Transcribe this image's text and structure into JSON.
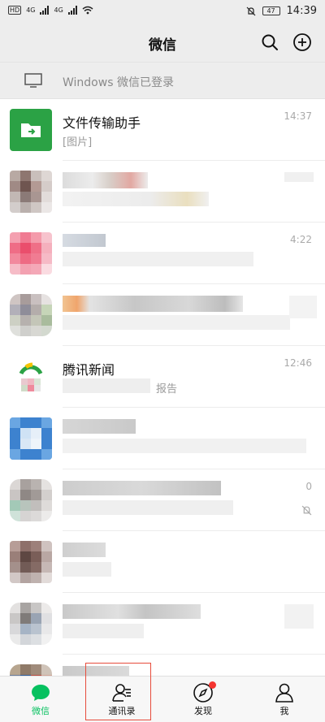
{
  "status_bar": {
    "time": "14:39",
    "battery": "47",
    "network_left": "4G",
    "network_right": "4G",
    "hd_badge": "HD"
  },
  "header": {
    "title": "微信",
    "search_icon": "search-icon",
    "add_icon": "plus-circle-icon"
  },
  "windows_bar": {
    "text": "Windows 微信已登录",
    "icon": "monitor-icon"
  },
  "chats": [
    {
      "name": "文件传输助手",
      "preview": "[图片]",
      "time": "14:37"
    },
    {
      "name": "",
      "preview": "",
      "time": ""
    },
    {
      "name": "",
      "preview": "",
      "time": "4:22"
    },
    {
      "name": "",
      "preview": "",
      "time": ""
    },
    {
      "name": "腾讯新闻",
      "preview": "报告",
      "time": "12:46"
    },
    {
      "name": "",
      "preview": "",
      "time": ""
    },
    {
      "name": "",
      "preview": "",
      "time": "0"
    },
    {
      "name": "",
      "preview": "",
      "time": ""
    },
    {
      "name": "",
      "preview": "",
      "time": ""
    },
    {
      "name": "",
      "preview": "",
      "time": ""
    }
  ],
  "tabs": [
    {
      "label": "微信",
      "icon": "chat-bubble-icon",
      "active": true
    },
    {
      "label": "通讯录",
      "icon": "contacts-icon",
      "active": false
    },
    {
      "label": "发现",
      "icon": "compass-icon",
      "active": false,
      "badge_dot": true
    },
    {
      "label": "我",
      "icon": "person-icon",
      "active": false
    }
  ],
  "colors": {
    "accent": "#07c160",
    "badge": "#f43530",
    "highlight_box": "#e74c3c"
  }
}
